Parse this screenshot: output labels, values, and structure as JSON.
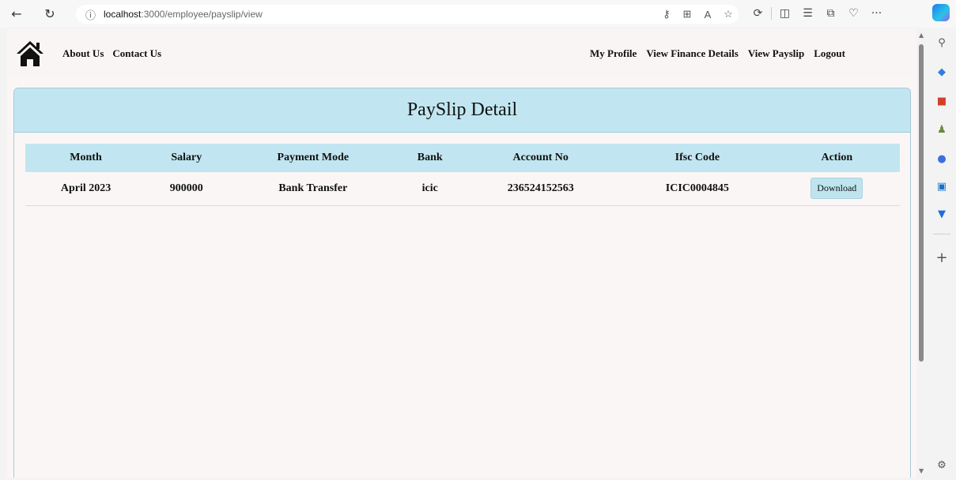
{
  "browser": {
    "url_host": "localhost",
    "url_rest": ":3000/employee/payslip/view",
    "menu_label": "···"
  },
  "nav": {
    "left_links": [
      "About Us",
      "Contact Us"
    ],
    "right_links": [
      "My Profile",
      "View Finance Details",
      "View Payslip",
      "Logout"
    ]
  },
  "card": {
    "title": "PaySlip Detail"
  },
  "table": {
    "headers": [
      "Month",
      "Salary",
      "Payment Mode",
      "Bank",
      "Account No",
      "Ifsc Code",
      "Action"
    ],
    "rows": [
      {
        "month": "April 2023",
        "salary": "900000",
        "payment_mode": "Bank Transfer",
        "bank": "icic",
        "account_no": "236524152563",
        "ifsc_code": "ICIC0004845",
        "action_label": "Download"
      }
    ]
  },
  "colors": {
    "header_bg": "#c1e6f1",
    "page_bg": "#fbf6f6",
    "button_bg": "#bfe4ee"
  }
}
